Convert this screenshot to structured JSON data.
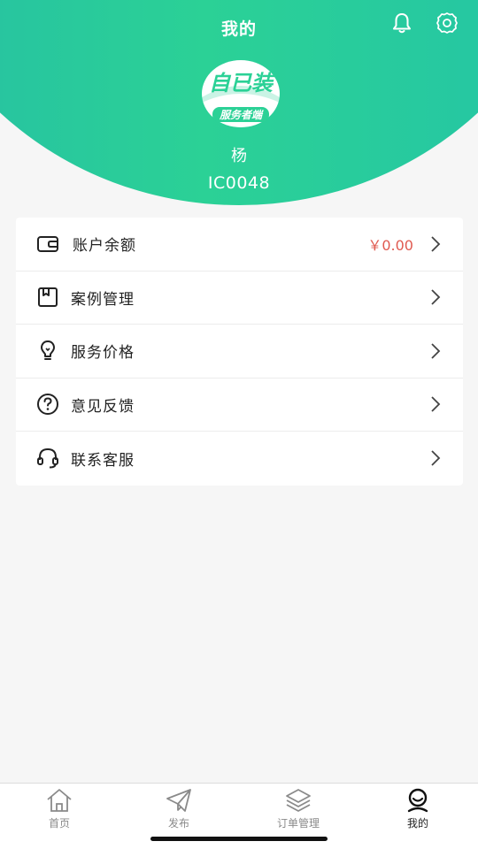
{
  "header": {
    "title": "我的",
    "bell_icon": "bell-icon",
    "settings_icon": "gear-icon"
  },
  "profile": {
    "logo_text": "自已装",
    "logo_subtext": "服务者端",
    "name": "杨",
    "id": "IC0048"
  },
  "menu": {
    "items": [
      {
        "label": "账户余额",
        "value": "￥0.00",
        "icon": "wallet-icon"
      },
      {
        "label": "案例管理",
        "icon": "case-folder-icon"
      },
      {
        "label": "服务价格",
        "icon": "lightbulb-icon"
      },
      {
        "label": "意见反馈",
        "icon": "question-icon"
      },
      {
        "label": "联系客服",
        "icon": "headset-icon"
      }
    ]
  },
  "tabbar": {
    "tabs": [
      {
        "label": "首页",
        "icon": "home-icon"
      },
      {
        "label": "发布",
        "icon": "send-icon"
      },
      {
        "label": "订单管理",
        "icon": "layers-icon"
      },
      {
        "label": "我的",
        "icon": "profile-icon",
        "active": true
      }
    ]
  },
  "colors": {
    "brand_green": "#2bd196",
    "amount_red": "#e05a50"
  }
}
